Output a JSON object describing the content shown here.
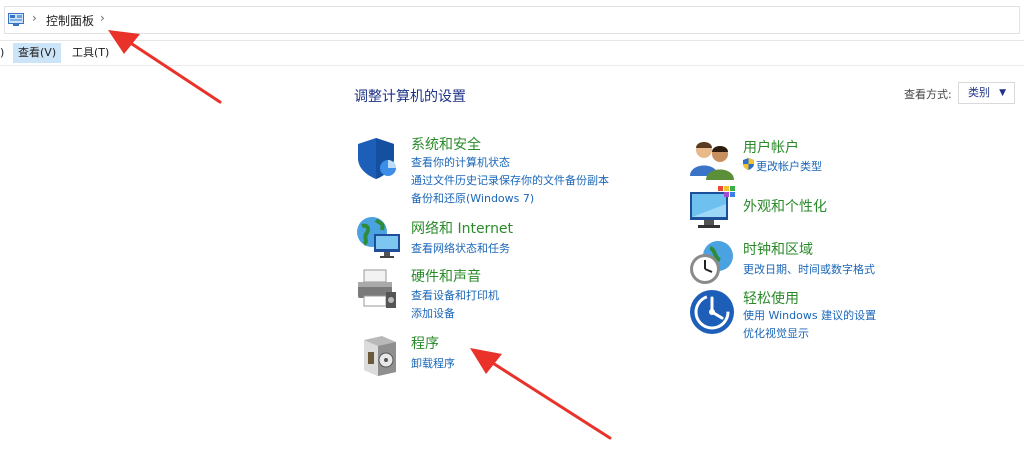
{
  "address": {
    "breadcrumb": "控制面板",
    "sep1": "›",
    "sep2": "›"
  },
  "menu": {
    "edge": ")",
    "view": "查看(V)",
    "tools": "工具(T)"
  },
  "main": {
    "title": "调整计算机的设置",
    "view_by_label": "查看方式:",
    "view_by_value": "类别",
    "view_by_caret": "▼"
  },
  "categories": {
    "system": {
      "title": "系统和安全",
      "links": [
        "查看你的计算机状态",
        "通过文件历史记录保存你的文件备份副本",
        "备份和还原(Windows 7)"
      ]
    },
    "network": {
      "title": "网络和 Internet",
      "links": [
        "查看网络状态和任务"
      ]
    },
    "hardware": {
      "title": "硬件和声音",
      "links": [
        "查看设备和打印机",
        "添加设备"
      ]
    },
    "programs": {
      "title": "程序",
      "links": [
        "卸载程序"
      ]
    },
    "users": {
      "title": "用户帐户",
      "links": [
        "更改帐户类型"
      ]
    },
    "appearance": {
      "title": "外观和个性化",
      "links": []
    },
    "clock": {
      "title": "时钟和区域",
      "links": [
        "更改日期、时间或数字格式"
      ]
    },
    "ease": {
      "title": "轻松使用",
      "links": [
        "使用 Windows 建议的设置",
        "优化视觉显示"
      ]
    }
  },
  "colors": {
    "title_green": "#2a8a2a",
    "link_blue": "#1a66b8",
    "heading_blue": "#1e3287",
    "annotation_red": "#e8322a"
  }
}
